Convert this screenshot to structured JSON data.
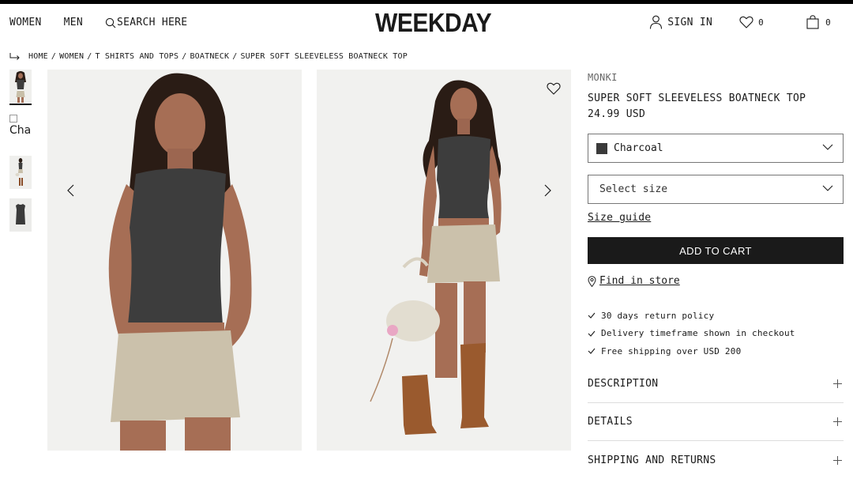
{
  "header": {
    "nav_women": "WOMEN",
    "nav_men": "MEN",
    "search_label": "SEARCH HERE",
    "logo": "WEEKDAY",
    "signin_label": "SIGN IN",
    "wishlist_count": "0",
    "bag_count": "0"
  },
  "breadcrumb": {
    "items": [
      "HOME",
      "WOMEN",
      "T SHIRTS AND TOPS",
      "BOATNECK",
      "SUPER SOFT SLEEVELESS BOATNECK TOP"
    ],
    "separator": "/"
  },
  "thumbnails": {
    "broken_alt": "Cha"
  },
  "product": {
    "brand": "MONKI",
    "name": "SUPER SOFT SLEEVELESS BOATNECK TOP",
    "price": "24.99 USD",
    "color_label": "Charcoal",
    "color_swatch": "#3a3a3a",
    "size_placeholder": "Select size",
    "size_guide": "Size guide",
    "add_to_cart": "ADD TO CART",
    "find_in_store": "Find in store",
    "benefits": [
      "30 days return policy",
      "Delivery timeframe shown in checkout",
      "Free shipping over USD 200"
    ],
    "accordions": [
      "DESCRIPTION",
      "DETAILS",
      "SHIPPING AND RETURNS"
    ]
  },
  "colors": {
    "accent": "#1a1a1a",
    "image_bg": "#f1f1ef"
  }
}
